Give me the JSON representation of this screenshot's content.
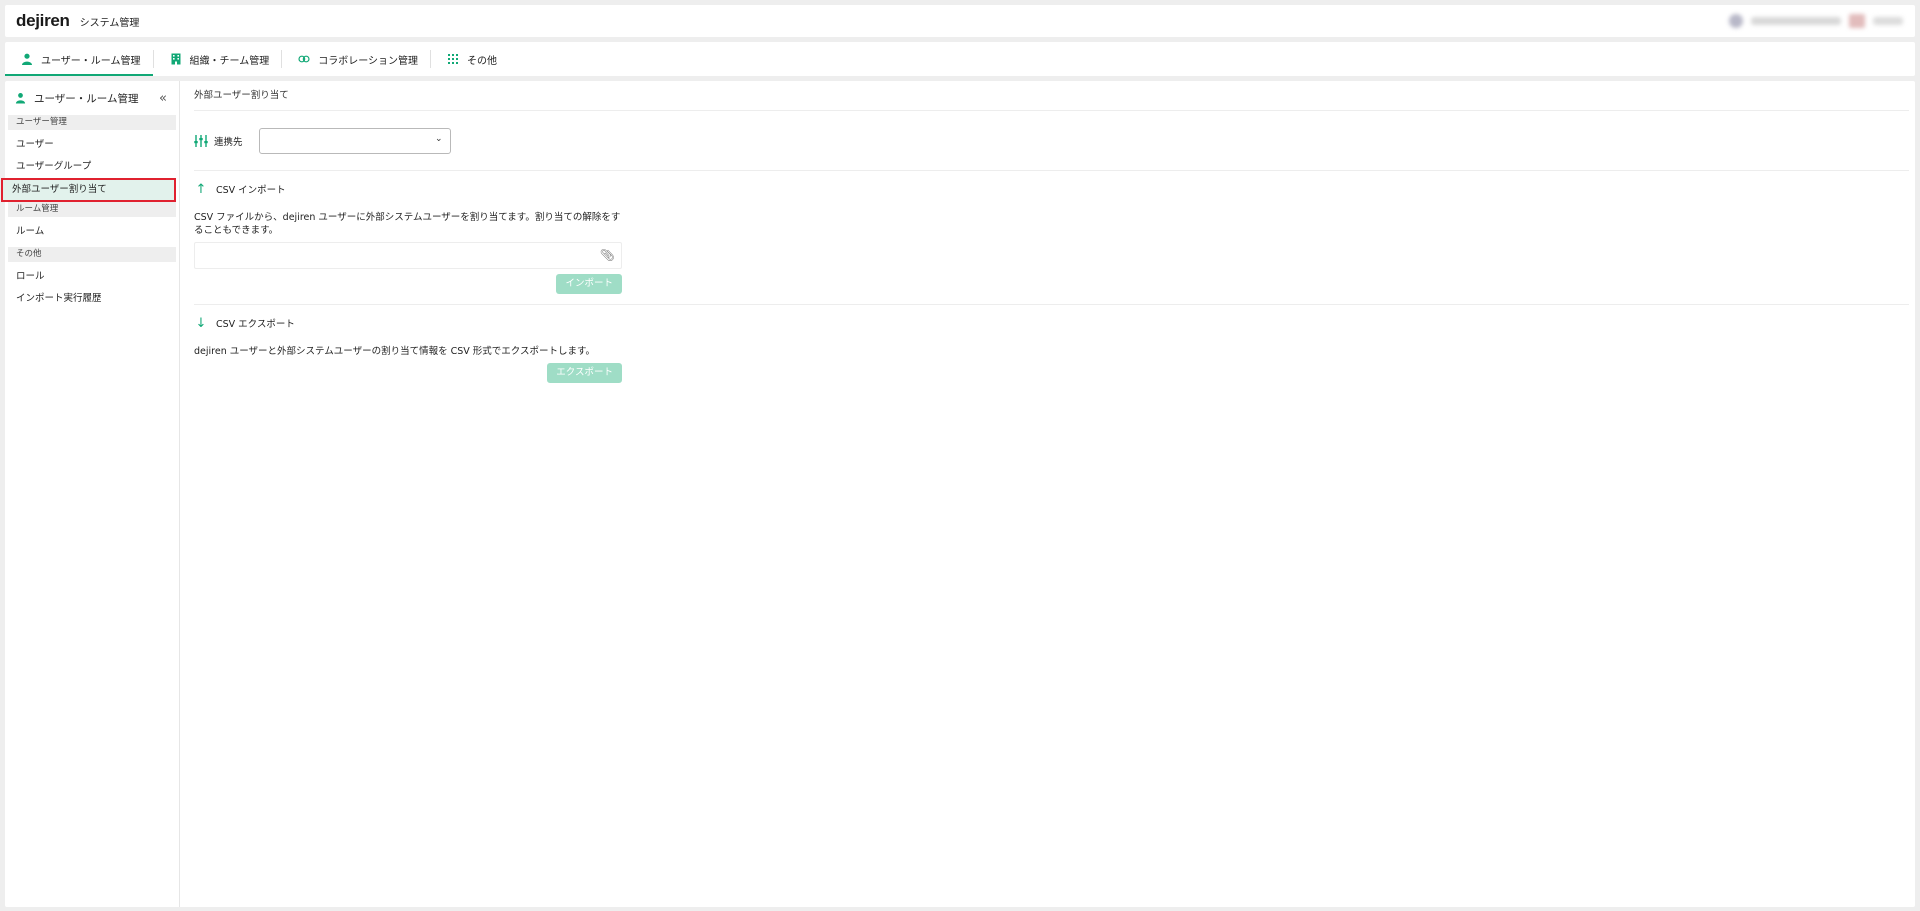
{
  "header": {
    "logo": "dejiren",
    "app_title": "システム管理"
  },
  "nav": {
    "tabs": [
      {
        "label": "ユーザー・ルーム管理",
        "icon": "person-icon",
        "active": true
      },
      {
        "label": "組織・チーム管理",
        "icon": "building-icon",
        "active": false
      },
      {
        "label": "コラボレーション管理",
        "icon": "link-icon",
        "active": false
      },
      {
        "label": "その他",
        "icon": "grid-icon",
        "active": false
      }
    ]
  },
  "sidebar": {
    "title": "ユーザー・ルーム管理",
    "collapse_icon": "«",
    "groups": [
      {
        "label": "ユーザー管理",
        "items": [
          "ユーザー",
          "ユーザーグループ",
          "外部ユーザー割り当て"
        ]
      },
      {
        "label": "ルーム管理",
        "items": [
          "ルーム"
        ]
      },
      {
        "label": "その他",
        "items": [
          "ロール",
          "インポート実行履歴"
        ]
      }
    ],
    "selected": "外部ユーザー割り当て"
  },
  "main": {
    "breadcrumb": "外部ユーザー割り当て",
    "integration": {
      "label": "連携先",
      "value": ""
    },
    "import": {
      "title": "CSV インポート",
      "description": "CSV ファイルから、dejiren ユーザーに外部システムユーザーを割り当てます。割り当ての解除をすることもできます。",
      "button": "インポート"
    },
    "export": {
      "title": "CSV エクスポート",
      "description": "dejiren ユーザーと外部システムユーザーの割り当て情報を CSV 形式でエクスポートします。",
      "button": "エクスポート"
    }
  },
  "colors": {
    "accent": "#11a876",
    "button_disabled": "#9fddc6",
    "selected_bg": "#e2f2ec",
    "highlight_border": "#e0212f"
  }
}
